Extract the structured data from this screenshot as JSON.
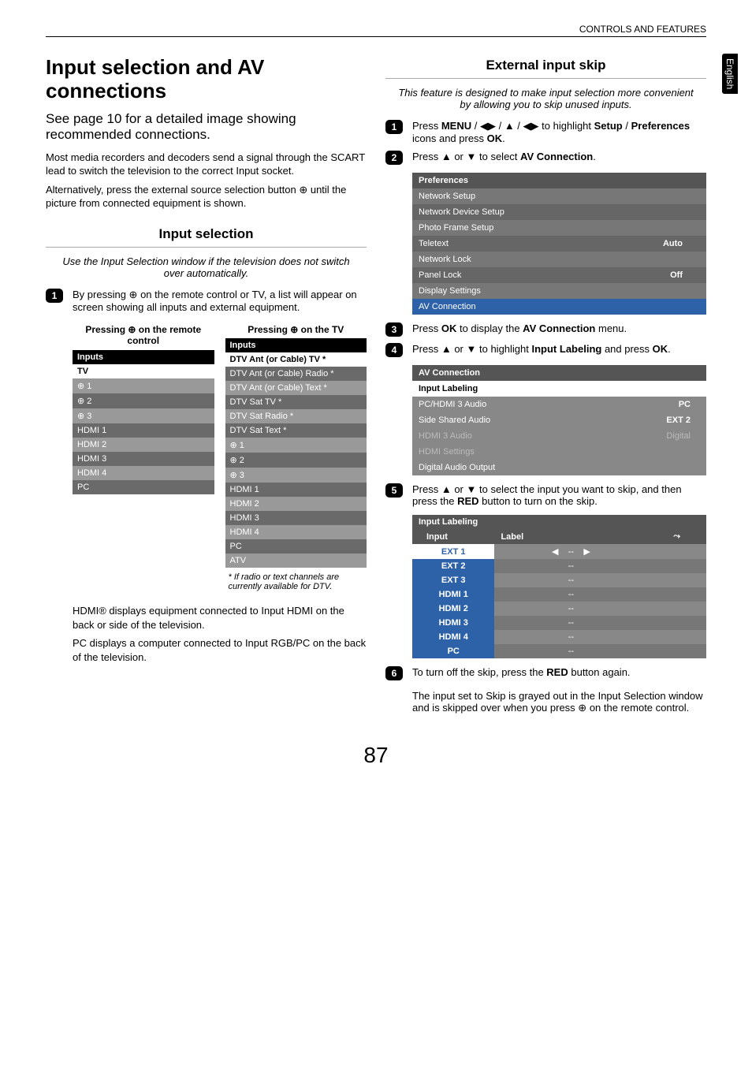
{
  "header": {
    "breadcrumb": "CONTROLS AND FEATURES",
    "side_tab": "English"
  },
  "left": {
    "title": "Input selection and AV connections",
    "intro": "See page 10 for a detailed image showing recommended connections.",
    "para1": "Most media recorders and decoders send a signal through the SCART lead to switch the television to the correct Input socket.",
    "para2a": "Alternatively, press the external source selection button ",
    "para2b": " until the picture from connected equipment is shown.",
    "h2": "Input selection",
    "sub": "Use the Input Selection window if the television does not switch over automatically.",
    "step1a": "By pressing ",
    "step1b": " on the remote control or TV, a list will appear on screen showing all inputs and external equipment.",
    "cap_remote_a": "Pressing ",
    "cap_remote_b": " on the remote control",
    "cap_tv_a": "Pressing ",
    "cap_tv_b": " on the TV",
    "tbl_left_header": "Inputs",
    "tbl_left": [
      "TV",
      "⊕ 1",
      "⊕ 2",
      "⊕ 3",
      "HDMI 1",
      "HDMI 2",
      "HDMI 3",
      "HDMI 4",
      "PC"
    ],
    "tbl_right_header": "Inputs",
    "tbl_right": [
      "DTV Ant (or Cable) TV *",
      "DTV Ant (or Cable) Radio *",
      "DTV Ant (or Cable) Text *",
      "DTV Sat TV *",
      "DTV Sat Radio *",
      "DTV Sat Text *",
      "⊕ 1",
      "⊕ 2",
      "⊕ 3",
      "HDMI 1",
      "HDMI 2",
      "HDMI 3",
      "HDMI 4",
      "PC",
      "ATV"
    ],
    "footnote": "*  If radio or text channels are currently available for DTV.",
    "para3": "HDMI® displays equipment connected to Input HDMI on the back or side of the television.",
    "para4": "PC displays a computer connected to Input RGB/PC on the back of the television."
  },
  "right": {
    "h2": "External input skip",
    "sub": "This feature is designed to make input selection more convenient by allowing you to skip unused inputs.",
    "s1a": "Press ",
    "s1_menu": "MENU",
    "s1_sep": " / ",
    "s1b": " / ",
    "s1c": " / ",
    "s1d": " to highlight ",
    "s1_setup": "Setup",
    "s1e": " / ",
    "s1_pref": "Preferences",
    "s1f": " icons and press ",
    "s1_ok": "OK",
    "s1g": ".",
    "s2a": "Press ",
    "s2b": " or ",
    "s2c": " to select ",
    "s2_av": "AV Connection",
    "s2d": ".",
    "pref_header": "Preferences",
    "pref_rows": [
      {
        "label": "Network Setup",
        "val": ""
      },
      {
        "label": "Network Device Setup",
        "val": ""
      },
      {
        "label": "Photo Frame Setup",
        "val": ""
      },
      {
        "label": "Teletext",
        "val": "Auto"
      },
      {
        "label": "Network Lock",
        "val": ""
      },
      {
        "label": "Panel Lock",
        "val": "Off"
      },
      {
        "label": "Display Settings",
        "val": ""
      },
      {
        "label": "AV Connection",
        "val": "",
        "hl": true
      }
    ],
    "s3a": "Press ",
    "s3_ok": "OK",
    "s3b": " to display the ",
    "s3_av": "AV Connection",
    "s3c": " menu.",
    "s4a": "Press ",
    "s4b": " or ",
    "s4c": " to highlight ",
    "s4_lbl": "Input Labeling",
    "s4d": " and press ",
    "s4_ok": "OK",
    "s4e": ".",
    "av_header": "AV Connection",
    "av_rows": [
      {
        "label": "Input Labeling",
        "val": "",
        "white": true
      },
      {
        "label": "PC/HDMI 3 Audio",
        "val": "PC"
      },
      {
        "label": "Side Shared Audio",
        "val": "EXT 2"
      },
      {
        "label": "HDMI 3 Audio",
        "val": "Digital",
        "dim": true
      },
      {
        "label": "HDMI Settings",
        "val": "",
        "dim": true
      },
      {
        "label": "Digital Audio Output",
        "val": ""
      }
    ],
    "s5a": "Press  ",
    "s5b": " or ",
    "s5c": " to select the input you want to skip, and then press the ",
    "s5_red": "RED",
    "s5d": " button to turn on the skip.",
    "lab_title": "Input Labeling",
    "lab_cols": [
      "Input",
      "Label",
      ""
    ],
    "lab_rows": [
      {
        "name": "EXT 1",
        "w": true,
        "arrows": true
      },
      {
        "name": "EXT 2"
      },
      {
        "name": "EXT 3"
      },
      {
        "name": "HDMI 1"
      },
      {
        "name": "HDMI 2"
      },
      {
        "name": "HDMI 3"
      },
      {
        "name": "HDMI 4"
      },
      {
        "name": "PC"
      }
    ],
    "lab_val": "--",
    "s6a": "To turn off the skip, press the ",
    "s6_red": "RED",
    "s6b": " button again.",
    "tail1": "The input set to Skip is grayed out in the Input Selection window and is skipped over when you press ",
    "tail2": " on the remote control."
  },
  "glyphs": {
    "input_icon": "⊕",
    "up": "▲",
    "down": "▼",
    "left": "◀",
    "right": "▶",
    "leftright": "◀▶",
    "lr_small_l": "◀",
    "lr_small_r": "▶"
  },
  "page_number": "87"
}
